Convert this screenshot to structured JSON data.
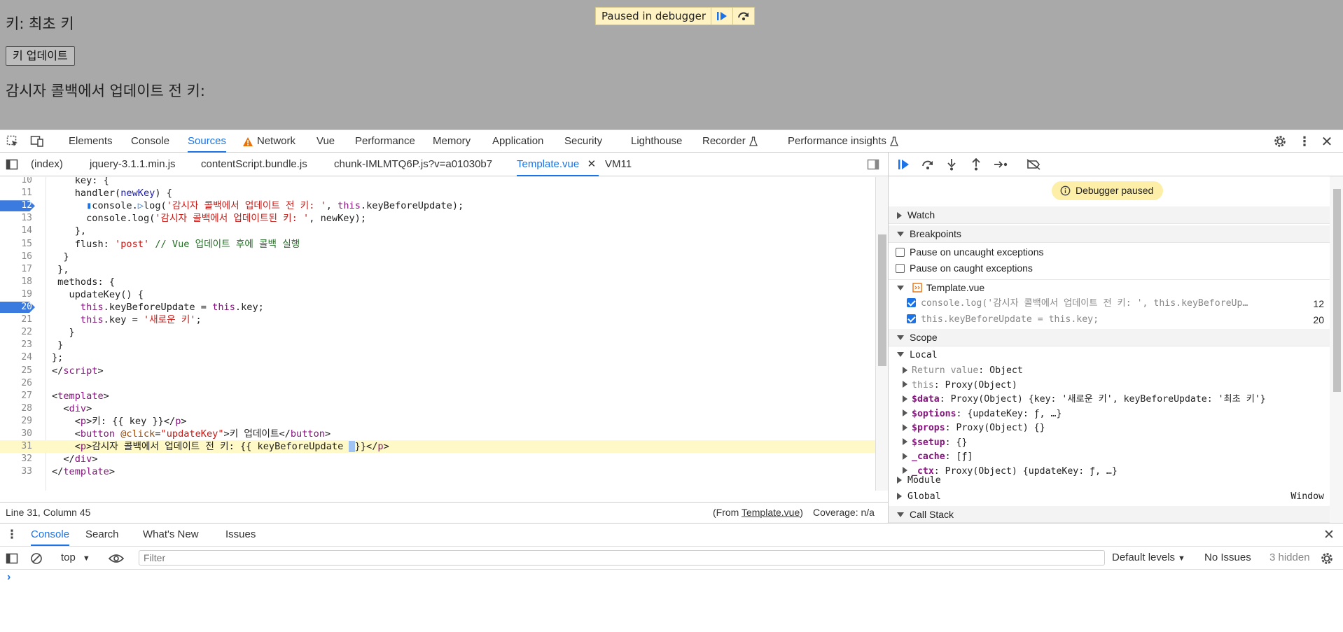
{
  "page": {
    "key_line": "키: 최초 키",
    "update_button": "키 업데이트",
    "watcher_line": "감시자 콜백에서 업데이트 전 키:",
    "paused_banner": "Paused in debugger"
  },
  "main_tabs": [
    "Elements",
    "Console",
    "Sources",
    "Network",
    "Vue",
    "Performance",
    "Memory",
    "Application",
    "Security",
    "Lighthouse",
    "Recorder",
    "Performance insights"
  ],
  "active_main_tab": "Sources",
  "file_tabs": [
    "(index)",
    "jquery-3.1.1.min.js",
    "contentScript.bundle.js",
    "chunk-IMLMTQ6P.js?v=a01030b7",
    "Template.vue",
    "VM11"
  ],
  "active_file_tab": "Template.vue",
  "editor": {
    "lines": [
      {
        "n": "10",
        "html": "    <span>key: {</span>"
      },
      {
        "n": "11",
        "html": "    handler(<span class='vr'>newKey</span>) {"
      },
      {
        "n": "12",
        "html": "      <span style='color:#1a73e8'>&#9646;</span>console.<span style='color:#1a73e8'>&#9655;</span>log(<span class='st'>'감시자 콜백에서 업데이트 전 키: '</span>, <span class='kw'>this</span>.keyBeforeUpdate);"
      },
      {
        "n": "13",
        "html": "      console.log(<span class='st'>'감시자 콜백에서 업데이트된 키: '</span>, newKey);"
      },
      {
        "n": "14",
        "html": "    },"
      },
      {
        "n": "15",
        "html": "    flush: <span class='st'>'post'</span> <span class='cm'>// Vue 업데이트 후에 콜백 실행</span>"
      },
      {
        "n": "16",
        "html": "  }"
      },
      {
        "n": "17",
        "html": " },"
      },
      {
        "n": "18",
        "html": " methods: {"
      },
      {
        "n": "19",
        "html": "   updateKey() {"
      },
      {
        "n": "20",
        "html": "     <span class='kw'>this</span>.keyBeforeUpdate = <span class='kw'>this</span>.key;"
      },
      {
        "n": "21",
        "html": "     <span class='kw'>this</span>.key = <span class='st'>'새로운 키'</span>;"
      },
      {
        "n": "22",
        "html": "   }"
      },
      {
        "n": "23",
        "html": " }"
      },
      {
        "n": "24",
        "html": "};"
      },
      {
        "n": "25",
        "html": "&lt;/<span class='tg'>script</span>&gt;"
      },
      {
        "n": "26",
        "html": ""
      },
      {
        "n": "27",
        "html": "&lt;<span class='tg'>template</span>&gt;"
      },
      {
        "n": "28",
        "html": "  &lt;<span class='tg'>div</span>&gt;"
      },
      {
        "n": "29",
        "html": "    &lt;<span class='tg'>p</span>&gt;키: {{ key }}&lt;/<span class='tg'>p</span>&gt;"
      },
      {
        "n": "30",
        "html": "    &lt;<span class='tg'>button</span> <span class='at'>@click</span>=<span class='st'>\"updateKey\"</span>&gt;키 업데이트&lt;/<span class='tg'>button</span>&gt;"
      },
      {
        "n": "31",
        "html": "    &lt;<span class='tg'>p</span>&gt;감시자 콜백에서 업데이트 전 키: {{ keyBeforeUpdate <span style='background:#9fc3f2'>&nbsp;</span>}}&lt;/<span class='tg'>p</span>&gt;"
      },
      {
        "n": "32",
        "html": "  &lt;/<span class='tg'>div</span>&gt;"
      },
      {
        "n": "33",
        "html": "&lt;/<span class='tg'>template</span>&gt;"
      }
    ],
    "breakpoint_lines": [
      "12",
      "20"
    ],
    "highlight_line": "31"
  },
  "status": {
    "position": "Line 31, Column 45",
    "from_prefix": "(From ",
    "from_file": "Template.vue",
    "from_suffix": ")",
    "coverage": "Coverage: n/a"
  },
  "debugger": {
    "paused_label": "Debugger paused",
    "watch": "Watch",
    "breakpoints": "Breakpoints",
    "pause_uncaught": "Pause on uncaught exceptions",
    "pause_caught": "Pause on caught exceptions",
    "bp_file": "Template.vue",
    "bp_items": [
      {
        "code": "console.log('감시자 콜백에서 업데이트 전 키: ', this.keyBeforeUp…",
        "line": "12"
      },
      {
        "code": "this.keyBeforeUpdate = this.key;",
        "line": "20"
      }
    ],
    "scope": "Scope",
    "local": "Local",
    "module": "Module",
    "global": "Global",
    "global_value": "Window",
    "call_stack": "Call Stack"
  },
  "scope_items": [
    {
      "key": "Return value",
      "sep": ": ",
      "val": "Object",
      "kstyle": "gray"
    },
    {
      "key": "this",
      "sep": ": ",
      "val": "Proxy(Object)",
      "kstyle": "gray"
    },
    {
      "key": "$data",
      "sep": ": ",
      "val": "Proxy(Object) {key: '새로운 키', keyBeforeUpdate: '최초 키'}",
      "kstyle": "purp"
    },
    {
      "key": "$options",
      "sep": ": ",
      "val": "{updateKey: ƒ, …}",
      "kstyle": "purp"
    },
    {
      "key": "$props",
      "sep": ": ",
      "val": "Proxy(Object) {}",
      "kstyle": "purp"
    },
    {
      "key": "$setup",
      "sep": ": ",
      "val": "{}",
      "kstyle": "purp"
    },
    {
      "key": "_cache",
      "sep": ": ",
      "val": "[ƒ]",
      "kstyle": "purp"
    },
    {
      "key": "_ctx",
      "sep": ": ",
      "val": "Proxy(Object) {updateKey: ƒ, …}",
      "kstyle": "purp"
    }
  ],
  "drawer": {
    "tabs": [
      "Console",
      "Search",
      "What's New",
      "Issues"
    ],
    "active_tab": "Console",
    "context": "top",
    "filter_placeholder": "Filter",
    "levels": "Default levels",
    "no_issues": "No Issues",
    "hidden": "3 hidden"
  }
}
